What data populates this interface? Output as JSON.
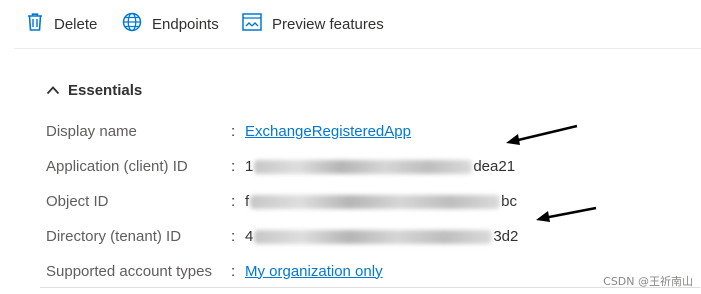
{
  "toolbar": {
    "delete_label": "Delete",
    "endpoints_label": "Endpoints",
    "preview_label": "Preview features"
  },
  "essentials": {
    "title": "Essentials",
    "colon": ":",
    "rows": [
      {
        "label": "Display name",
        "value": "ExchangeRegisteredApp"
      },
      {
        "label": "Application (client) ID",
        "prefix": "1",
        "suffix": "dea21"
      },
      {
        "label": "Object ID",
        "prefix": "f",
        "suffix": "bc"
      },
      {
        "label": "Directory (tenant) ID",
        "prefix": "4",
        "suffix": "3d2"
      },
      {
        "label": "Supported account types",
        "value": "My organization only"
      }
    ]
  },
  "watermark": "CSDN @王祈南山",
  "colors": {
    "link": "#0078d4",
    "icon": "#0078d4",
    "arrow": "#000000"
  }
}
